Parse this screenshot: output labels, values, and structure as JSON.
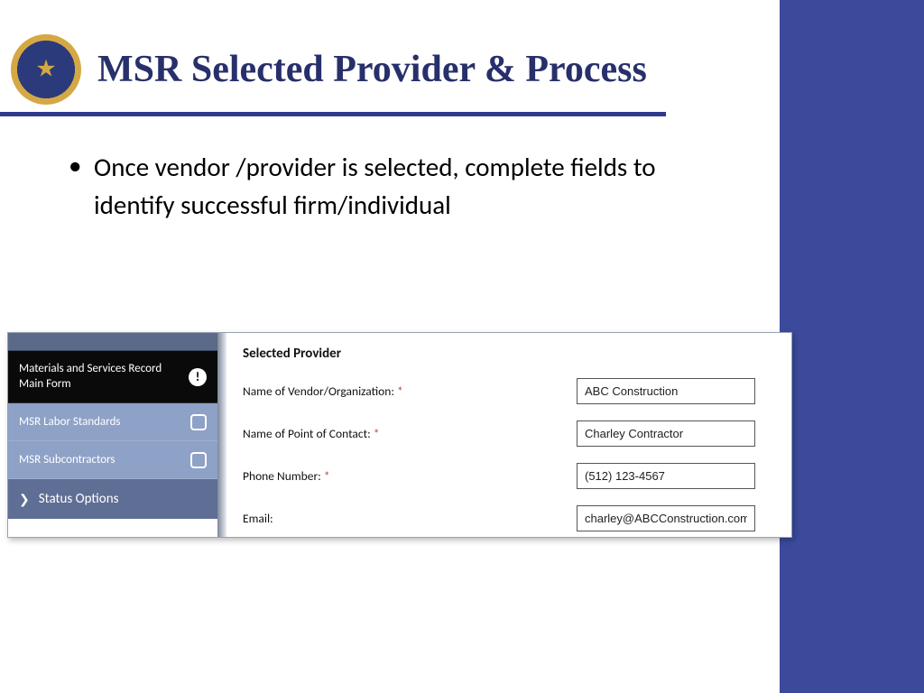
{
  "header": {
    "title": "MSR Selected Provider & Process"
  },
  "bullet": {
    "text": "Once vendor /provider is selected, complete fields to identify successful firm/individual"
  },
  "screenshot": {
    "sidebar": {
      "main_form": "Materials and Services Record Main Form",
      "labor_standards": "MSR Labor Standards",
      "subcontractors": "MSR Subcontractors",
      "status_options": "Status Options"
    },
    "form": {
      "section_title": "Selected Provider",
      "fields": {
        "vendor": {
          "label": "Name of Vendor/Organization:",
          "required": true,
          "value": "ABC Construction"
        },
        "contact": {
          "label": "Name of Point of Contact:",
          "required": true,
          "value": "Charley Contractor"
        },
        "phone": {
          "label": "Phone Number:",
          "required": true,
          "value": "(512) 123-4567"
        },
        "email": {
          "label": "Email:",
          "required": false,
          "value": "charley@ABCConstruction.com"
        }
      }
    }
  }
}
